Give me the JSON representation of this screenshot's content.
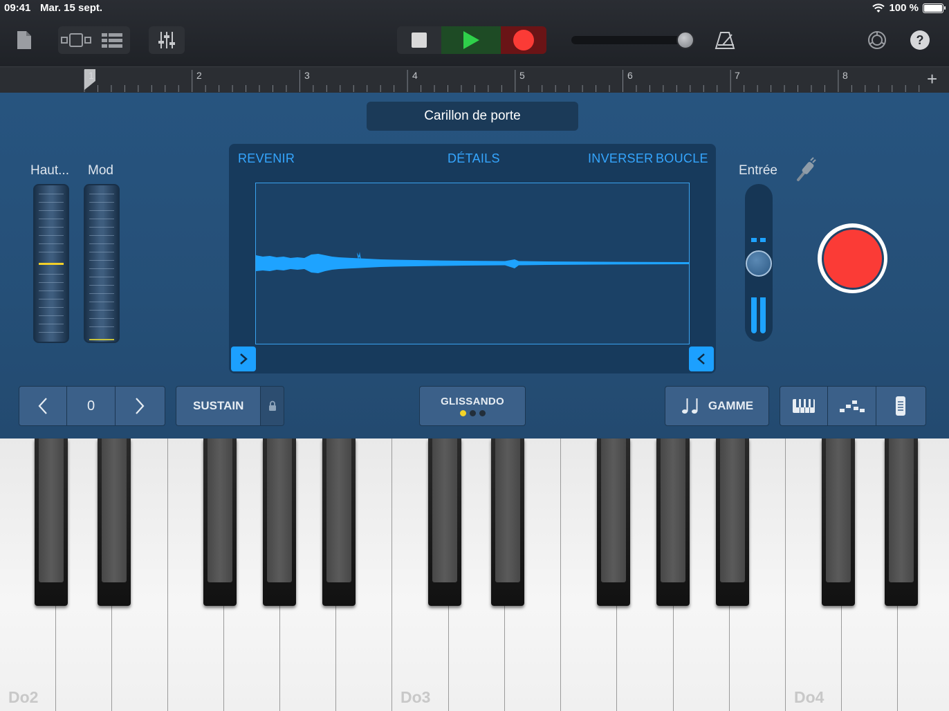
{
  "status": {
    "time": "09:41",
    "date": "Mar. 15 sept.",
    "battery": "100 %"
  },
  "ruler": {
    "bars": [
      "1",
      "2",
      "3",
      "4",
      "5",
      "6",
      "7",
      "8"
    ],
    "add": "+"
  },
  "preset": "Carillon de porte",
  "wheels": {
    "pitch": "Haut...",
    "mod": "Mod"
  },
  "sampler": {
    "revert": "REVENIR",
    "details": "DÉTAILS",
    "reverse": "INVERSER",
    "loop": "BOUCLE"
  },
  "input": {
    "label": "Entrée"
  },
  "controls": {
    "octave_value": "0",
    "sustain": "SUSTAIN",
    "glissando": "GLISSANDO",
    "scale": "GAMME"
  },
  "keyboard": {
    "labels": [
      "Do2",
      "Do3",
      "Do4"
    ]
  },
  "colors": {
    "accent": "#35a6ff",
    "record": "#fb3b36",
    "play": "#2fd04a"
  },
  "icons": [
    "document-icon",
    "tracks-view-icon",
    "mixer-icon",
    "stop-icon",
    "play-icon",
    "record-icon",
    "metronome-icon",
    "settings-icon",
    "help-icon",
    "plug-icon",
    "keyboard-icon",
    "arpeggiator-icon",
    "controller-icon"
  ]
}
